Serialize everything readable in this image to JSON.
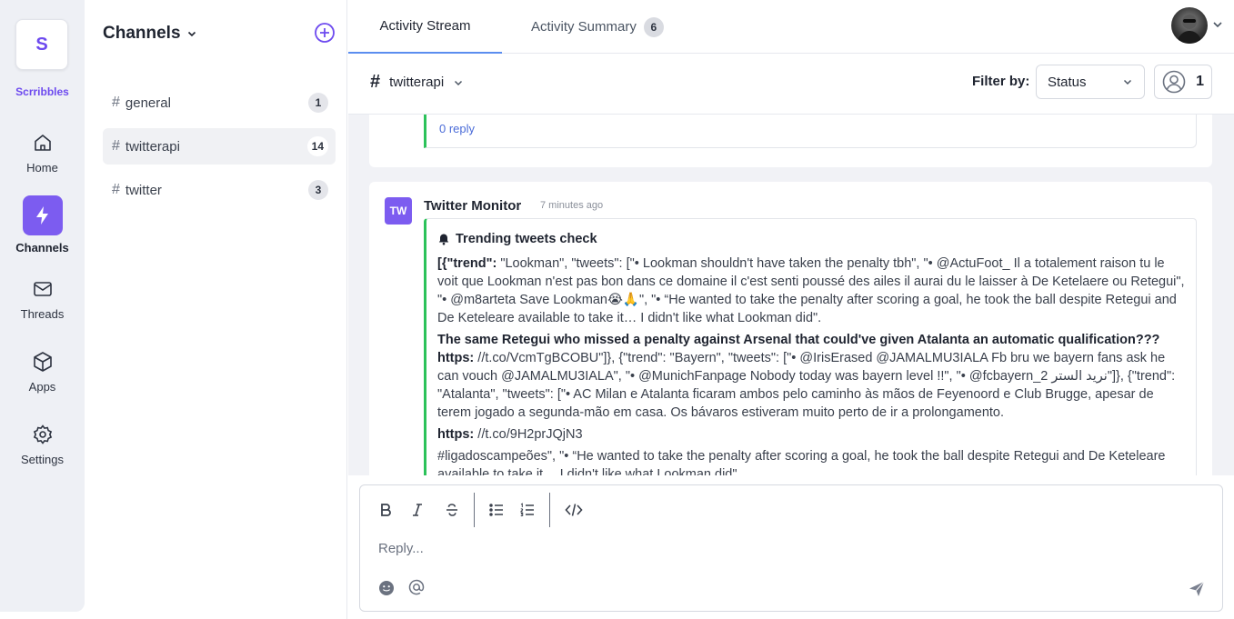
{
  "app": {
    "logo_letter": "S",
    "name": "Scrribbles"
  },
  "rail": {
    "home": "Home",
    "channels": "Channels",
    "threads": "Threads",
    "apps": "Apps",
    "settings": "Settings"
  },
  "channels_panel": {
    "title": "Channels",
    "items": [
      {
        "name": "general",
        "count": "1"
      },
      {
        "name": "twitterapi",
        "count": "14"
      },
      {
        "name": "twitter",
        "count": "3"
      }
    ]
  },
  "tabs": {
    "stream": "Activity Stream",
    "summary": "Activity Summary",
    "summary_badge": "6"
  },
  "subbar": {
    "channel": "twitterapi",
    "filter_label": "Filter by:",
    "filter_value": "Status",
    "user_count": "1"
  },
  "prev_message": {
    "reply_link": "0 reply"
  },
  "message": {
    "avatar_initials": "TW",
    "sender": "Twitter Monitor",
    "time": "7 minutes ago",
    "title": "Trending tweets check",
    "p1_bold": "[{\"trend\":",
    "p1_text": " \"Lookman\", \"tweets\": [\"• Lookman shouldn't have taken the penalty tbh\", \"• @ActuFoot_ Il a totalement raison tu le voit que Lookman n'est pas bon dans ce domaine il c'est senti poussé des ailes il aurai du le laisser à De Ketelaere ou Retegui\", \"• @m8arteta Save Lookman😭🙏\", \"• “He wanted to take the penalty after scoring a goal, he took the ball despite Retegui and De Keteleare available to take it… I didn't like what Lookman did\".",
    "p2_bold": "The same Retegui who missed a penalty against Arsenal that could've given Atalanta an automatic qualification??? https:",
    "p2_text": " //t.co/VcmTgBCOBU\"]}, {\"trend\": \"Bayern\", \"tweets\": [\"• @IrisErased @JAMALMU3IALA Fb bru we bayern fans ask he can vouch @JAMALMU3IALA\", \"• @MunichFanpage Nobody today was bayern level !!\", \"• @fcbayern_2 نريد الستر\"]}, {\"trend\": \"Atalanta\", \"tweets\": [\"• AC Milan e Atalanta ficaram ambos pelo caminho às mãos de Feyenoord e Club Brugge, apesar de terem jogado a segunda-mão em casa. Os bávaros estiveram muito perto de ir a prolongamento.",
    "p3_bold": "https:",
    "p3_text": " //t.co/9H2prJQjN3",
    "p4_text": "#ligadoscampeões\", \"• “He wanted to take the penalty after scoring a goal, he took the ball despite Retegui and De Keteleare available to take it… I didn't like what Lookman did\"."
  },
  "composer": {
    "placeholder": "Reply..."
  },
  "colors": {
    "accent": "#7c5cf0",
    "thread_bar": "#2cc25a",
    "tab_underline": "#5b8def"
  }
}
